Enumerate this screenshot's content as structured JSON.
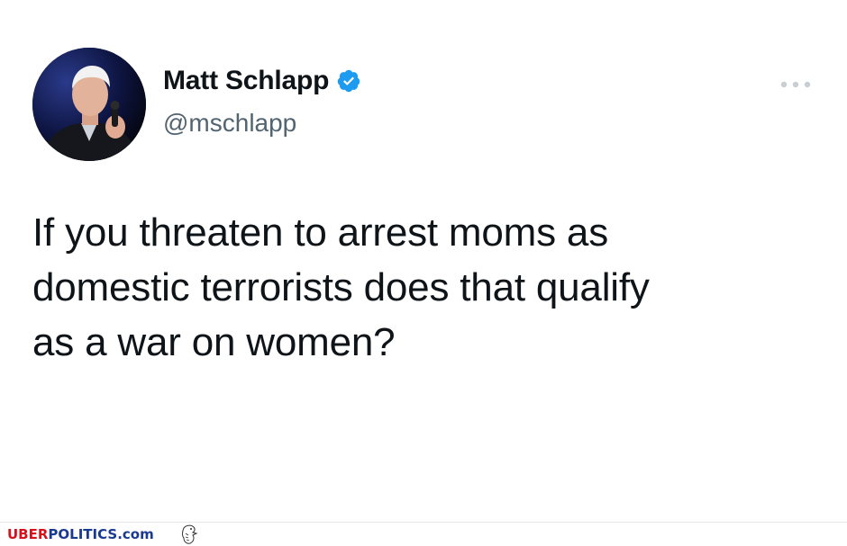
{
  "tweet": {
    "author": {
      "display_name": "Matt Schlapp",
      "handle": "@mschlapp",
      "verified": true
    },
    "text_lines": [
      "If you threaten to arrest moms as",
      "domestic terrorists does that qualify",
      "as a war on women?"
    ],
    "menu_icon": "more-horizontal-icon"
  },
  "watermark": {
    "part1": "UBER",
    "part2": "POLITICS",
    "part3": ".com",
    "logo_icon": "eagle-icon"
  },
  "colors": {
    "verified_blue": "#1d9bf0",
    "text": "#0f1419",
    "secondary_text": "#536471",
    "watermark_red": "#d4111c",
    "watermark_blue": "#1a3a8f"
  }
}
